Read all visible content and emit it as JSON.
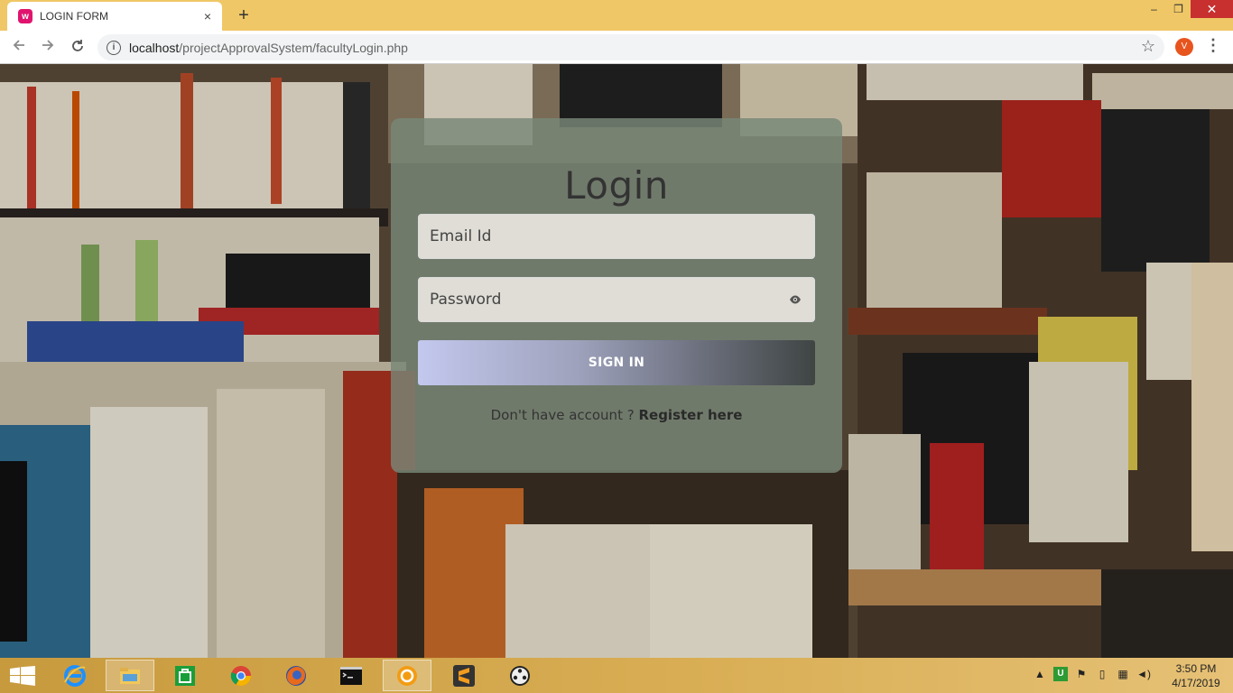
{
  "browser": {
    "tab_title": "LOGIN FORM",
    "tab_close": "×",
    "new_tab": "+",
    "favicon_letter": "w",
    "url_host": "localhost",
    "url_path": "/projectApprovalSystem/facultyLogin.php",
    "profile_initial": "V",
    "window_minimize": "–",
    "window_restore": "❐",
    "window_close": "✕"
  },
  "login": {
    "title": "Login",
    "email_placeholder": "Email Id",
    "password_placeholder": "Password",
    "signin_label": "SIGN IN",
    "register_prompt": "Don't have account ?",
    "register_link": "Register here"
  },
  "taskbar": {
    "apps": [
      "windows-explorer",
      "internet-explorer",
      "file-explorer",
      "store",
      "chrome",
      "firefox",
      "command-prompt",
      "xampp",
      "sublime-text",
      "media-player"
    ],
    "time": "3:50 PM",
    "date": "4/17/2019"
  },
  "colors": {
    "titlebar": "#efc766",
    "card": "#788778",
    "signin_gradient_start": "#c3c8ee",
    "signin_gradient_end": "#3f4544",
    "taskbar": "#d8ad53"
  }
}
